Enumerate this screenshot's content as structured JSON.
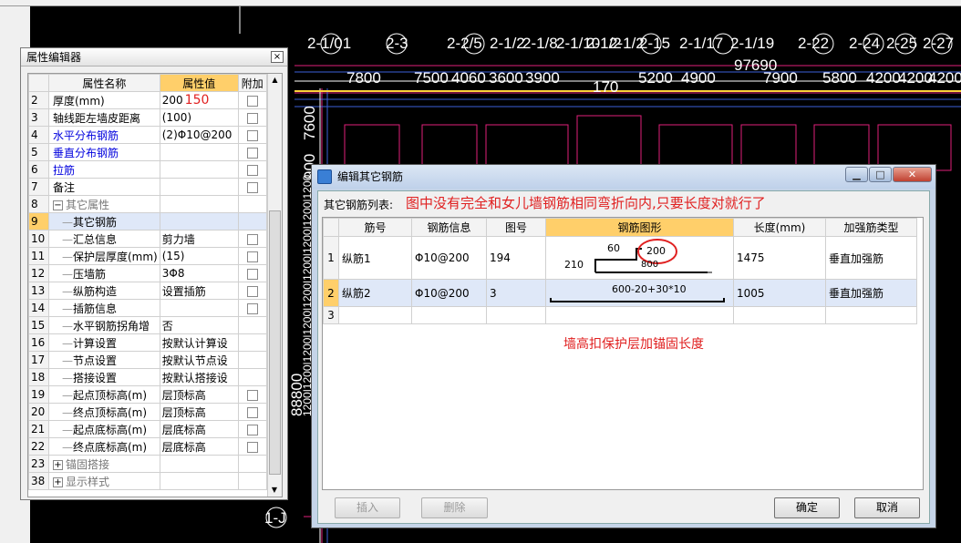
{
  "cad": {
    "axes": [
      "2-1/01",
      "2-3",
      "2-2/5",
      "2-1/2",
      "2-1/8",
      "2-1/10",
      "2-1/2",
      "2-1/2",
      "2-15",
      "2-1/17",
      "2-1/19",
      "2-22",
      "2-24",
      "2-25",
      "2-27"
    ],
    "left_axis": "1-J",
    "dims_top": [
      "7800",
      "7500",
      "4060",
      "3600",
      "3900",
      "5200",
      "4900",
      "7900",
      "5800",
      "4200",
      "4200",
      "4200"
    ],
    "dim_97690": "97690",
    "dim_170": "170",
    "vdim_7600": "7600",
    "vdim_88800": "88800",
    "vdim_900": "900",
    "vdim_row": "1200|1200|1200|1200|1200|1200|1200|1200|1200"
  },
  "prop_editor": {
    "title": "属性编辑器",
    "close": "×",
    "headers": {
      "name": "属性名称",
      "value": "属性值",
      "extra": "附加"
    },
    "rows": [
      {
        "no": "2",
        "name": "厚度(mm)",
        "value": "200",
        "note": "150",
        "cb": true,
        "style": "",
        "indent": false
      },
      {
        "no": "3",
        "name": "轴线距左墙皮距离",
        "value": "(100)",
        "note": "",
        "cb": true,
        "style": "",
        "indent": false
      },
      {
        "no": "4",
        "name": "水平分布钢筋",
        "value": "(2)Φ10@200",
        "note": "",
        "cb": true,
        "style": "blue",
        "indent": false
      },
      {
        "no": "5",
        "name": "垂直分布钢筋",
        "value": "",
        "note": "",
        "cb": true,
        "style": "blue",
        "indent": false
      },
      {
        "no": "6",
        "name": "拉筋",
        "value": "",
        "note": "",
        "cb": true,
        "style": "blue",
        "indent": false
      },
      {
        "no": "7",
        "name": "备注",
        "value": "",
        "note": "",
        "cb": true,
        "style": "",
        "indent": false
      },
      {
        "no": "8",
        "name": "其它属性",
        "value": "",
        "note": "",
        "cb": false,
        "style": "gray",
        "indent": false,
        "expander": "−"
      },
      {
        "no": "9",
        "name": "其它钢筋",
        "value": "",
        "note": "",
        "cb": false,
        "style": "",
        "indent": true,
        "selected": true
      },
      {
        "no": "10",
        "name": "汇总信息",
        "value": "剪力墙",
        "note": "",
        "cb": true,
        "style": "",
        "indent": true
      },
      {
        "no": "11",
        "name": "保护层厚度(mm)",
        "value": "(15)",
        "note": "",
        "cb": true,
        "style": "",
        "indent": true
      },
      {
        "no": "12",
        "name": "压墙筋",
        "value": "3Φ8",
        "note": "",
        "cb": true,
        "style": "",
        "indent": true
      },
      {
        "no": "13",
        "name": "纵筋构造",
        "value": "设置插筋",
        "note": "",
        "cb": true,
        "style": "",
        "indent": true
      },
      {
        "no": "14",
        "name": "插筋信息",
        "value": "",
        "note": "",
        "cb": true,
        "style": "",
        "indent": true
      },
      {
        "no": "15",
        "name": "水平钢筋拐角增",
        "value": "否",
        "note": "",
        "cb": false,
        "style": "",
        "indent": true
      },
      {
        "no": "16",
        "name": "计算设置",
        "value": "按默认计算设",
        "note": "",
        "cb": false,
        "style": "",
        "indent": true
      },
      {
        "no": "17",
        "name": "节点设置",
        "value": "按默认节点设",
        "note": "",
        "cb": false,
        "style": "",
        "indent": true
      },
      {
        "no": "18",
        "name": "搭接设置",
        "value": "按默认搭接设",
        "note": "",
        "cb": false,
        "style": "",
        "indent": true
      },
      {
        "no": "19",
        "name": "起点顶标高(m)",
        "value": "层顶标高",
        "note": "",
        "cb": true,
        "style": "",
        "indent": true
      },
      {
        "no": "20",
        "name": "终点顶标高(m)",
        "value": "层顶标高",
        "note": "",
        "cb": true,
        "style": "",
        "indent": true
      },
      {
        "no": "21",
        "name": "起点底标高(m)",
        "value": "层底标高",
        "note": "",
        "cb": true,
        "style": "",
        "indent": true
      },
      {
        "no": "22",
        "name": "终点底标高(m)",
        "value": "层底标高",
        "note": "",
        "cb": true,
        "style": "",
        "indent": true
      },
      {
        "no": "23",
        "name": "锚固搭接",
        "value": "",
        "note": "",
        "cb": false,
        "style": "gray",
        "indent": false,
        "expander": "+"
      },
      {
        "no": "38",
        "name": "显示样式",
        "value": "",
        "note": "",
        "cb": false,
        "style": "gray",
        "indent": false,
        "expander": "+"
      }
    ]
  },
  "dialog": {
    "title": "编辑其它钢筋",
    "list_label": "其它钢筋列表:",
    "note1": "图中没有完全和女儿墙钢筋相同弯折向内,只要长度对就行了",
    "note2": "墙高扣保护层加锚固长度",
    "headers": [
      "",
      "筋号",
      "钢筋信息",
      "图号",
      "钢筋图形",
      "长度(mm)",
      "加强筋类型"
    ],
    "rows": [
      {
        "no": "1",
        "name": "纵筋1",
        "info": "Φ10@200",
        "fig": "194",
        "length": "1475",
        "type": "垂直加强筋"
      },
      {
        "no": "2",
        "name": "纵筋2",
        "info": "Φ10@200",
        "fig": "3",
        "length": "1005",
        "type": "垂直加强筋"
      },
      {
        "no": "3",
        "name": "",
        "info": "",
        "fig": "",
        "length": "",
        "type": ""
      }
    ],
    "shape1": {
      "a": "60",
      "b": "200",
      "c": "210",
      "d": "800"
    },
    "shape2": {
      "formula": "600-20+30*10"
    },
    "buttons": {
      "insert": "插入",
      "delete": "删除",
      "ok": "确定",
      "cancel": "取消"
    }
  },
  "colors": {
    "accent": "#ffcf6a",
    "note": "#e02020",
    "cad_line": "#e0207a"
  }
}
